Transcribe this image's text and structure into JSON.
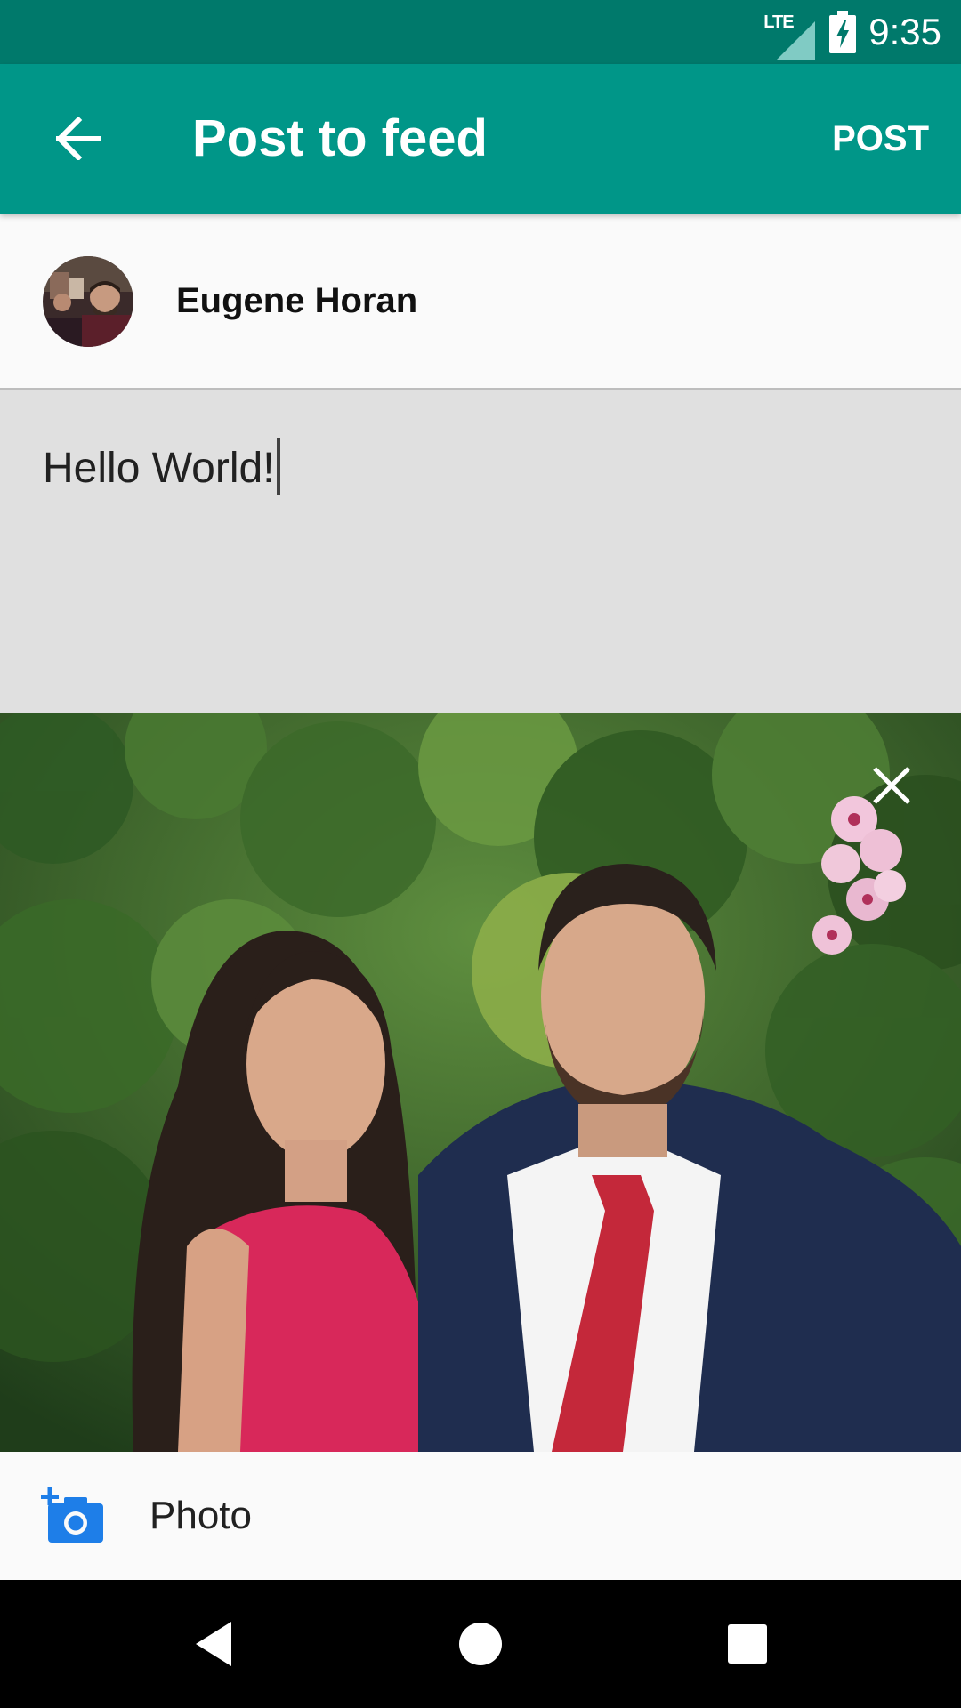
{
  "status_bar": {
    "network": "LTE",
    "time": "9:35"
  },
  "app_bar": {
    "title": "Post to feed",
    "post_label": "POST"
  },
  "user": {
    "name": "Eugene Horan"
  },
  "composer": {
    "text": "Hello World!"
  },
  "add_photo": {
    "label": "Photo"
  },
  "colors": {
    "status_bar": "#00796b",
    "app_bar": "#009688",
    "composer_bg": "#e0e0e0",
    "photo_icon": "#1e7ee8"
  },
  "icons": {
    "back": "arrow-back-icon",
    "remove_photo": "close-icon",
    "add_photo": "add-a-photo-icon",
    "nav_back": "nav-back-icon",
    "nav_home": "nav-home-icon",
    "nav_recents": "nav-recents-icon"
  }
}
